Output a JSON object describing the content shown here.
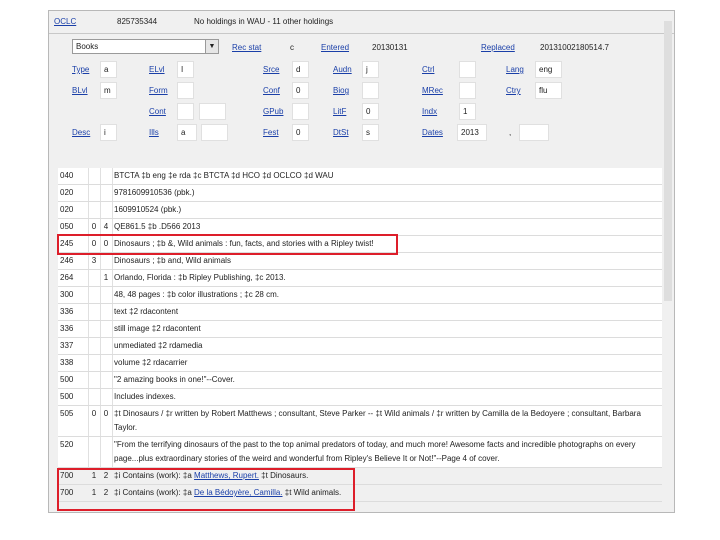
{
  "header": {
    "oclc_label": "OCLC",
    "oclc_number": "825735344",
    "holdings_text": "No holdings in WAU - 11 other holdings"
  },
  "fixed": {
    "format_select": "Books",
    "rec_stat_label": "Rec stat",
    "rec_stat": "c",
    "entered_label": "Entered",
    "entered": "20130131",
    "replaced_label": "Replaced",
    "replaced": "20131002180514.7",
    "type_label": "Type",
    "type": "a",
    "elvl_label": "ELvl",
    "elvl": "I",
    "srce_label": "Srce",
    "srce": "d",
    "audn_label": "Audn",
    "audn": "j",
    "ctrl_label": "Ctrl",
    "ctrl": "",
    "lang_label": "Lang",
    "lang": "eng",
    "blvl_label": "BLvl",
    "blvl": "m",
    "form_label": "Form",
    "form": "",
    "conf_label": "Conf",
    "conf": "0",
    "biog_label": "Biog",
    "biog": "",
    "mrec_label": "MRec",
    "mrec": "",
    "ctry_label": "Ctry",
    "ctry": "flu",
    "cont_label": "Cont",
    "cont": "",
    "gpub_label": "GPub",
    "gpub": "",
    "litf_label": "LitF",
    "litf": "0",
    "indx_label": "Indx",
    "indx": "1",
    "desc_label": "Desc",
    "desc": "i",
    "ills_label": "Ills",
    "ills": "a",
    "fest_label": "Fest",
    "fest": "0",
    "dtst_label": "DtSt",
    "dtst": "s",
    "dates_label": "Dates",
    "dates1": "2013",
    "dates_sep": ","
  },
  "fields": [
    {
      "tag": "040",
      "i1": "",
      "i2": "",
      "text": "BTCTA ‡b eng ‡e rda ‡c BTCTA ‡d HCO ‡d OCLCO ‡d WAU"
    },
    {
      "tag": "020",
      "i1": "",
      "i2": "",
      "text": "9781609910536 (pbk.)"
    },
    {
      "tag": "020",
      "i1": "",
      "i2": "",
      "text": "1609910524 (pbk.)"
    },
    {
      "tag": "050",
      "i1": "0",
      "i2": "4",
      "text": "QE861.5 ‡b .D566 2013"
    },
    {
      "tag": "245",
      "i1": "0",
      "i2": "0",
      "text": "Dinosaurs ; ‡b &, Wild animals : fun, facts, and stories with a Ripley twist!"
    },
    {
      "tag": "246",
      "i1": "3",
      "i2": "",
      "text": "Dinosaurs ; ‡b and, Wild animals"
    },
    {
      "tag": "264",
      "i1": "",
      "i2": "1",
      "text": "Orlando, Florida : ‡b Ripley Publishing, ‡c 2013."
    },
    {
      "tag": "300",
      "i1": "",
      "i2": "",
      "text": "48, 48 pages : ‡b color illustrations ; ‡c 28 cm."
    },
    {
      "tag": "336",
      "i1": "",
      "i2": "",
      "text": "text ‡2 rdacontent"
    },
    {
      "tag": "336",
      "i1": "",
      "i2": "",
      "text": "still image ‡2 rdacontent"
    },
    {
      "tag": "337",
      "i1": "",
      "i2": "",
      "text": "unmediated ‡2 rdamedia"
    },
    {
      "tag": "338",
      "i1": "",
      "i2": "",
      "text": "volume ‡2 rdacarrier"
    },
    {
      "tag": "500",
      "i1": "",
      "i2": "",
      "text": "\"2 amazing books in one!\"--Cover."
    },
    {
      "tag": "500",
      "i1": "",
      "i2": "",
      "text": "Includes indexes."
    },
    {
      "tag": "505",
      "i1": "0",
      "i2": "0",
      "text": "‡t Dinosaurs / ‡r written by Robert Matthews ; consultant, Steve Parker -- ‡t Wild animals / ‡r written by Camilla de la Bedoyere ; consultant, Barbara Taylor."
    },
    {
      "tag": "520",
      "i1": "",
      "i2": "",
      "text": "\"From the terrifying dinosaurs of the past to the top animal predators of today, and much more! Awesome facts and incredible photographs on every page...plus extraordinary stories of the weird and wonderful from Ripley's Believe It or Not!\"--Page 4 of cover."
    }
  ],
  "added": [
    {
      "tag": "700",
      "i1": "1",
      "i2": "2",
      "pre": "‡i Contains (work): ‡a ",
      "name": "Matthews, Rupert.",
      "post": " ‡t Dinosaurs."
    },
    {
      "tag": "700",
      "i1": "1",
      "i2": "2",
      "pre": "‡i Contains (work): ‡a ",
      "name": "De la Bédoyère, Camilla.",
      "post": " ‡t Wild animals."
    }
  ],
  "colors": {
    "highlight": "#dd1e2a",
    "link": "#1a3fa8"
  }
}
